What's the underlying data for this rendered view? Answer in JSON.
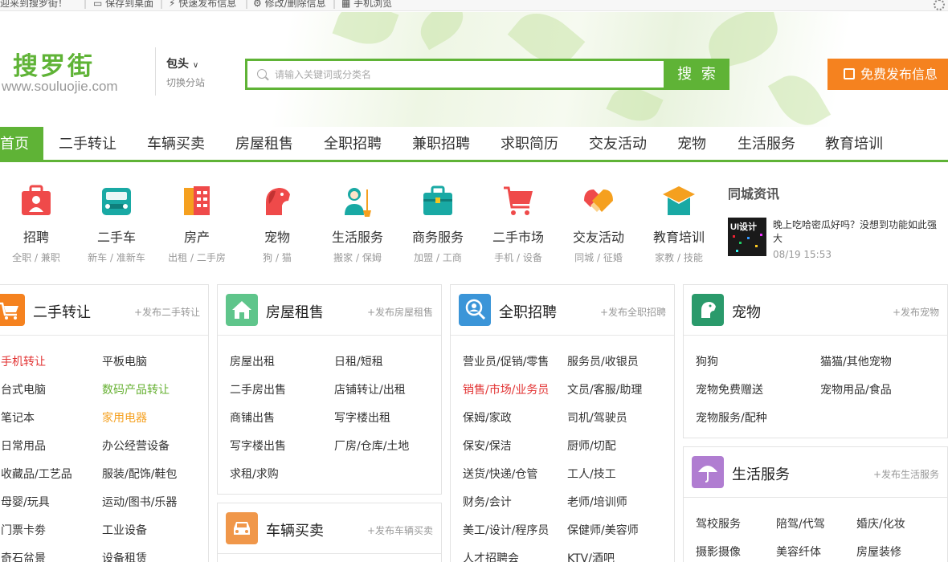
{
  "topbar": {
    "welcome": "迎来到搜罗街！",
    "save_desktop": "保存到桌面",
    "quick_post": "快速发布信息",
    "edit_delete": "修改/删除信息",
    "mobile": "手机浏览"
  },
  "header": {
    "logo_text": "搜罗街",
    "logo_url": "www.souluojie.com",
    "city": "包头",
    "city_switch": "切换分站",
    "search_placeholder": "请输入关键词或分类名",
    "search_button": "搜 索",
    "post_button": "免费发布信息"
  },
  "nav": {
    "items": [
      "首页",
      "二手转让",
      "车辆买卖",
      "房屋租售",
      "全职招聘",
      "兼职招聘",
      "求职简历",
      "交友活动",
      "宠物",
      "生活服务",
      "教育培训"
    ],
    "active_index": 0
  },
  "categories": [
    {
      "title": "招聘",
      "sub": "全职 / 兼职",
      "icon": "briefcase-person-icon",
      "color": "#ef4a4a"
    },
    {
      "title": "二手车",
      "sub": "新车 / 准新车",
      "icon": "car-icon",
      "color": "#19a9a4"
    },
    {
      "title": "房产",
      "sub": "出租 / 二手房",
      "icon": "building-icon",
      "color": "#ef4a4a"
    },
    {
      "title": "宠物",
      "sub": "狗 / 猫",
      "icon": "dog-icon",
      "color": "#ef4a4a"
    },
    {
      "title": "生活服务",
      "sub": "搬家 / 保姆",
      "icon": "cleaner-icon",
      "color": "#19a9a4"
    },
    {
      "title": "商务服务",
      "sub": "加盟 / 工商",
      "icon": "suitcase-icon",
      "color": "#19a9a4"
    },
    {
      "title": "二手市场",
      "sub": "手机 / 设备",
      "icon": "cart-icon",
      "color": "#ef4a4a"
    },
    {
      "title": "交友活动",
      "sub": "同城 / 征婚",
      "icon": "handshake-icon",
      "color": "#f5a01f"
    },
    {
      "title": "教育培训",
      "sub": "家教 / 技能",
      "icon": "graduation-cap-icon",
      "color": "#19a9a4"
    }
  ],
  "news": {
    "title": "同城资讯",
    "thumb_text": "UI设计",
    "headline": "晚上吃哈密瓜好吗？没想到功能如此强大",
    "time": "08/19 15:53"
  },
  "panels": {
    "secondhand": {
      "title": "二手转让",
      "post": "+发布二手转让",
      "color": "#f5821f",
      "links": [
        "手机转让",
        "平板电脑",
        "台式电脑",
        "数码产品转让",
        "笔记本",
        "家用电器",
        "日常用品",
        "办公经营设备",
        "收藏品/工艺品",
        "服装/配饰/鞋包",
        "母婴/玩具",
        "运动/图书/乐器",
        "门票卡劵",
        "工业设备",
        "奇石盆景",
        "设备租赁"
      ]
    },
    "housing": {
      "title": "房屋租售",
      "post": "+发布房屋租售",
      "color": "#5fc58b",
      "links": [
        "房屋出租",
        "日租/短租",
        "二手房出售",
        "店铺转让/出租",
        "商铺出售",
        "写字楼出租",
        "写字楼出售",
        "厂房/仓库/土地",
        "求租/求购"
      ]
    },
    "vehicle": {
      "title": "车辆买卖",
      "post": "+发布车辆买卖",
      "color": "#f0974a"
    },
    "jobs": {
      "title": "全职招聘",
      "post": "+发布全职招聘",
      "color": "#3b95d8",
      "links": [
        "营业员/促销/零售",
        "服务员/收银员",
        "销售/市场/业务员",
        "文员/客服/助理",
        "保姆/家政",
        "司机/驾驶员",
        "保安/保洁",
        "厨师/切配",
        "送货/快递/仓管",
        "工人/技工",
        "财务/会计",
        "老师/培训师",
        "美工/设计/程序员",
        "保健师/美容师",
        "人才招聘会",
        "KTV/酒吧"
      ]
    },
    "pets": {
      "title": "宠物",
      "post": "+发布宠物",
      "color": "#2a9a6b",
      "links": [
        "狗狗",
        "猫猫/其他宠物",
        "宠物免费赠送",
        "宠物用品/食品",
        "宠物服务/配种"
      ]
    },
    "life": {
      "title": "生活服务",
      "post": "+发布生活服务",
      "color": "#b07dd1",
      "links": [
        "驾校服务",
        "陪驾/代驾",
        "婚庆/化妆",
        "摄影摄像",
        "美容纤体",
        "房屋装修"
      ]
    }
  }
}
